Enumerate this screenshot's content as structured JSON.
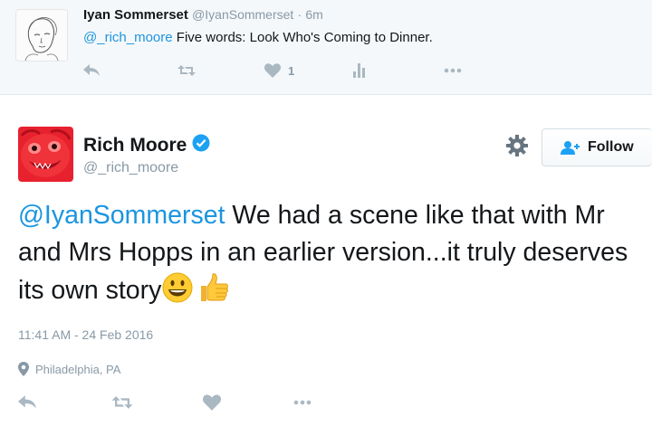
{
  "reply_tweet": {
    "name": "Iyan Sommerset",
    "handle": "@IyanSommerset",
    "separator": "·",
    "time": "6m",
    "mention": "@_rich_moore",
    "text": " Five words: Look Who's Coming to Dinner.",
    "like_count": "1",
    "icons": [
      "reply-icon",
      "retweet-icon",
      "heart-icon",
      "analytics-icon",
      "more-icon"
    ]
  },
  "main_tweet": {
    "name": "Rich Moore",
    "handle": "@_rich_moore",
    "verified": true,
    "follow_label": "Follow",
    "mention": "@IyanSommerset",
    "text": " We had a scene like that with Mr and Mrs Hopps in an earlier version...it truly deserves its own story",
    "emojis": [
      "grinning-face-emoji",
      "thumbs-up-emoji"
    ],
    "timestamp": "11:41 AM - 24 Feb 2016",
    "location": "Philadelphia, PA",
    "icons": [
      "reply-icon",
      "retweet-icon",
      "heart-icon",
      "more-icon",
      "gear-icon",
      "verified-badge-icon",
      "location-pin-icon"
    ]
  },
  "colors": {
    "link": "#1b95e0",
    "muted": "#8899a6",
    "action_icon": "#aab8c2",
    "reply_bg": "#f5f8fa",
    "verified": "#1da1f2"
  }
}
